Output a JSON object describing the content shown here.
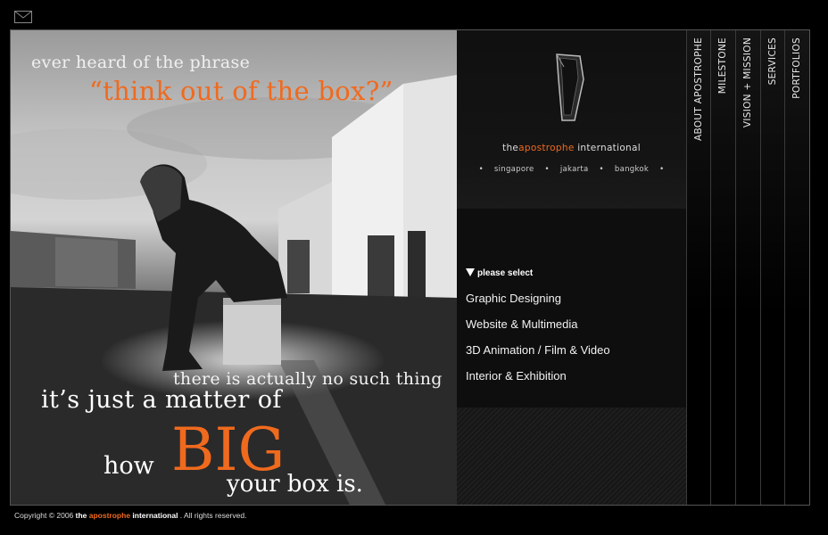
{
  "header": {
    "mail_icon": "envelope-icon"
  },
  "hero": {
    "line1": "ever heard of the phrase",
    "line2": "“think out of the box?”",
    "line3": "there is actually no such thing",
    "line4": "it’s just a matter of",
    "line5": "how",
    "line6": "BIG",
    "line7": "your box is.",
    "accent_color": "#f06a1e"
  },
  "brand": {
    "prefix": "the",
    "highlight": "apostrophe",
    "suffix": " international",
    "cities": [
      "singapore",
      "jakarta",
      "bangkok"
    ]
  },
  "menu": {
    "heading": "please select",
    "items": [
      "Graphic Designing",
      "Website & Multimedia",
      "3D Animation / Film & Video",
      "Interior & Exhibition"
    ]
  },
  "nav": {
    "items": [
      "ABOUT APOSTROPHE",
      "MILESTONE",
      "VISION + MISSION",
      "SERVICES",
      "PORTFOLIOS"
    ]
  },
  "footer": {
    "prefix": "Copyright © 2006 ",
    "the": "the",
    "highlight": "apostrophe",
    "name": "international",
    "suffix": " . All rights reserved."
  }
}
